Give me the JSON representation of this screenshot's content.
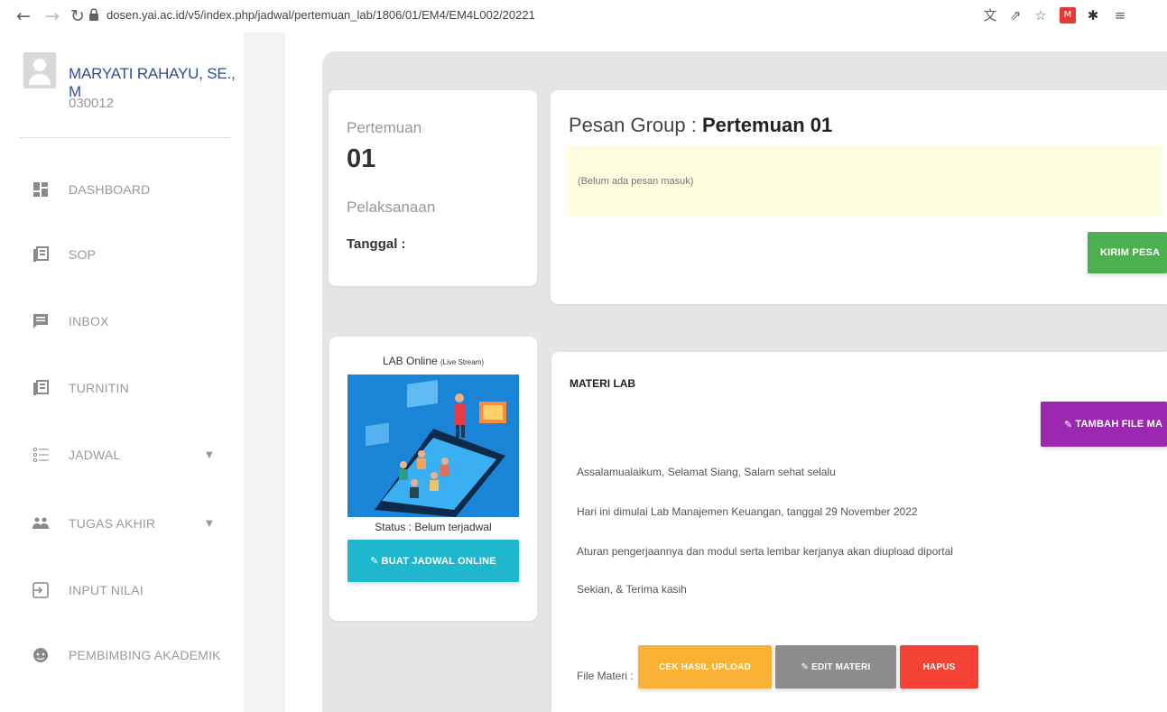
{
  "browser": {
    "url": "dosen.yai.ac.id/v5/index.php/jadwal/pertemuan_lab/1806/01/EM4/EM4L002/20221"
  },
  "sidebar": {
    "user_name": "MARYATI RAHAYU, SE., M",
    "user_id": "030012",
    "items": [
      {
        "label": "DASHBOARD",
        "icon": "dashboard-icon"
      },
      {
        "label": "SOP",
        "icon": "document-icon"
      },
      {
        "label": "INBOX",
        "icon": "message-icon"
      },
      {
        "label": "TURNITIN",
        "icon": "document-icon"
      },
      {
        "label": "JADWAL",
        "icon": "list-icon"
      },
      {
        "label": "TUGAS AKHIR",
        "icon": "people-icon"
      },
      {
        "label": "INPUT NILAI",
        "icon": "input-icon"
      },
      {
        "label": "PEMBIMBING AKADEMIK",
        "icon": "face-icon"
      }
    ]
  },
  "pertemuan": {
    "label": "Pertemuan",
    "number": "01",
    "pelaksanaan_label": "Pelaksanaan",
    "tanggal_label": "Tanggal :"
  },
  "pesan": {
    "title_prefix": "Pesan Group : ",
    "title_value": "Pertemuan 01",
    "empty_text": "(Belum ada pesan masuk)",
    "send_button": "KIRIM PESA"
  },
  "lab_online": {
    "title": "LAB Online",
    "subtitle": "(Live Stream)",
    "status": "Status : Belum terjadwal",
    "button": "BUAT JADWAL ONLINE"
  },
  "materi": {
    "title": "MATERI LAB",
    "add_button": "TAMBAH FILE MA",
    "lines": [
      "Assalamualaikum, Selamat Siang, Salam sehat selalu",
      "Hari ini dimulai Lab Manajemen Keuangan, tanggal 29 November 2022",
      "Aturan pengerjaannya dan modul serta lembar kerjanya akan diupload diportal",
      "Sekian, & Terima kasih"
    ],
    "file_label": "File Materi :",
    "check_button": "CEK HASIL UPLOAD",
    "edit_button": "EDIT MATERI",
    "delete_button": "HAPUS"
  },
  "colors": {
    "green": "#4caf50",
    "purple": "#9c27b0",
    "cyan": "#1fb7cd",
    "orange": "#f9b233",
    "gray": "#8d8d8d",
    "red": "#f44336",
    "name_blue": "#2f4f8f"
  }
}
